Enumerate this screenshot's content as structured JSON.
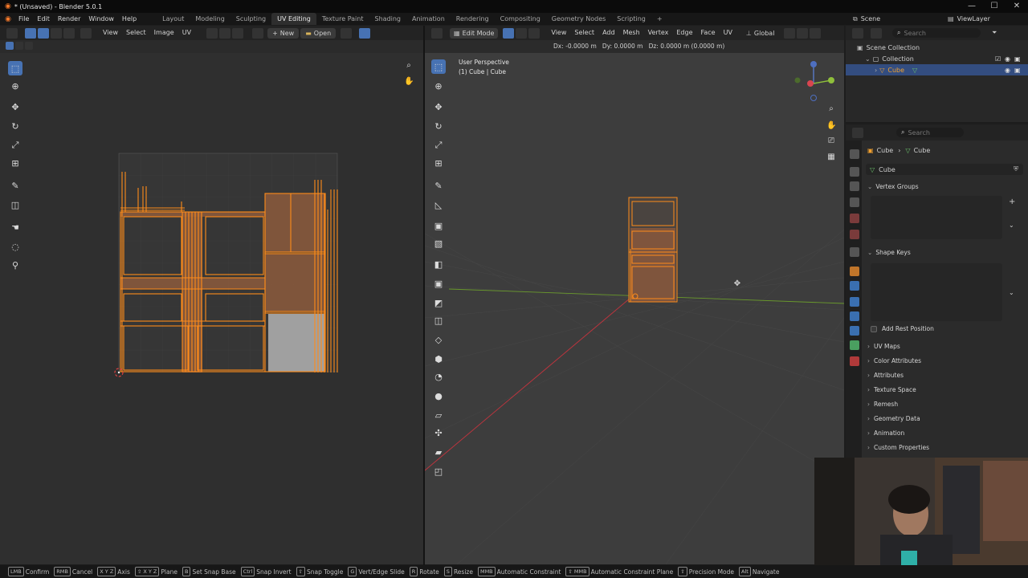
{
  "window": {
    "title": "* (Unsaved) - Blender 5.0.1",
    "minimize": "—",
    "maximize": "☐",
    "close": "✕"
  },
  "menu": [
    "File",
    "Edit",
    "Render",
    "Window",
    "Help"
  ],
  "workspaces": [
    "Layout",
    "Modeling",
    "Sculpting",
    "UV Editing",
    "Texture Paint",
    "Shading",
    "Animation",
    "Rendering",
    "Compositing",
    "Geometry Nodes",
    "Scripting"
  ],
  "workspace_active": "UV Editing",
  "add_workspace": "+",
  "scene": {
    "label": "Scene",
    "view_layer": "ViewLayer"
  },
  "uv_editor": {
    "menus": [
      "View",
      "Select",
      "Image",
      "UV"
    ],
    "new_label": "New",
    "open_label": "Open"
  },
  "viewport": {
    "mode": "Edit Mode",
    "menus": [
      "View",
      "Select",
      "Add",
      "Mesh",
      "Vertex",
      "Edge",
      "Face",
      "UV"
    ],
    "orientation": "Global",
    "transform_readout": "Dx: -0.0000 m   Dy: 0.0000 m   Dz: 0.0000 m (0.0000 m)",
    "overlay_title": "User Perspective",
    "overlay_object": "(1) Cube | Cube"
  },
  "outliner": {
    "search_placeholder": "Search",
    "items": [
      "Scene Collection",
      "Collection",
      "Cube"
    ]
  },
  "properties": {
    "search_placeholder": "Search",
    "breadcrumb": [
      "Cube",
      "Cube"
    ],
    "mesh_name": "Cube",
    "sections": {
      "vertex_groups": "Vertex Groups",
      "shape_keys": "Shape Keys",
      "add_rest_position": "Add Rest Position",
      "collapsed": [
        "UV Maps",
        "Color Attributes",
        "Attributes",
        "Texture Space",
        "Remesh",
        "Geometry Data",
        "Animation",
        "Custom Properties"
      ]
    }
  },
  "status_bar": [
    {
      "key": "LMB",
      "label": "Confirm"
    },
    {
      "key": "RMB",
      "label": "Cancel"
    },
    {
      "key": "X Y Z",
      "label": "Axis"
    },
    {
      "key": "⇧ X Y Z",
      "label": "Plane"
    },
    {
      "key": "B",
      "label": "Set Snap Base"
    },
    {
      "key": "Ctrl",
      "label": "Snap Invert"
    },
    {
      "key": "⇧",
      "label": "Snap Toggle"
    },
    {
      "key": "G",
      "label": "Vert/Edge Slide"
    },
    {
      "key": "R",
      "label": "Rotate"
    },
    {
      "key": "S",
      "label": "Resize"
    },
    {
      "key": "MMB",
      "label": "Automatic Constraint"
    },
    {
      "key": "⇧ MMB",
      "label": "Automatic Constraint Plane"
    },
    {
      "key": "⇧",
      "label": "Precision Mode"
    },
    {
      "key": "Alt",
      "label": "Navigate"
    }
  ],
  "colors": {
    "accent": "#4772b3",
    "selection": "#ff8c1a",
    "face_fill": "#8c5a3c",
    "grid": "#3a3a3a",
    "x_axis": "#c0343e",
    "y_axis": "#6a9a2c"
  }
}
